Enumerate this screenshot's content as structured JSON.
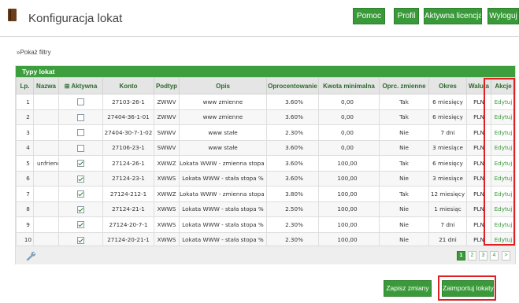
{
  "header": {
    "title": "Konfiguracja lokat",
    "buttons": {
      "help": "Pomoc",
      "profile": "Profil",
      "license": "Aktywna licencja",
      "logout": "Wyloguj"
    }
  },
  "filters_link": "»Pokaż filtry",
  "panel": {
    "title": "Typy lokat",
    "columns": {
      "lp": "Lp.",
      "name": "Nazwa",
      "active": "⊞ Aktywna",
      "account": "Konto",
      "type": "Podtyp",
      "description": "Opis",
      "rate": "Oprocentowanie",
      "min_amount": "Kwota minimalna",
      "rate_change": "Oprc. zmienne",
      "period": "Okres",
      "currency": "Waluta",
      "actions": "Akcje"
    },
    "rows": [
      {
        "lp": "1",
        "name": "",
        "active": false,
        "account": "27103-26-1",
        "type": "ZWWV",
        "description": "www zmienne",
        "rate": "3.60%",
        "min_amount": "0,00",
        "rate_change": "Tak",
        "period": "6 miesięcy",
        "currency": "PLN",
        "action": "Edytuj"
      },
      {
        "lp": "2",
        "name": "",
        "active": false,
        "account": "27404-36-1-01",
        "type": "ZWWV",
        "description": "www zmienne",
        "rate": "3.60%",
        "min_amount": "0,00",
        "rate_change": "Tak",
        "period": "6 miesięcy",
        "currency": "PLN",
        "action": "Edytuj"
      },
      {
        "lp": "3",
        "name": "",
        "active": false,
        "account": "27404-30-7-1-02",
        "type": "SWWV",
        "description": "www stałe",
        "rate": "2.30%",
        "min_amount": "0,00",
        "rate_change": "Nie",
        "period": "7 dni",
        "currency": "PLN",
        "action": "Edytuj"
      },
      {
        "lp": "4",
        "name": "",
        "active": false,
        "account": "27106-23-1",
        "type": "SWWV",
        "description": "www stałe",
        "rate": "3.60%",
        "min_amount": "0,00",
        "rate_change": "Nie",
        "period": "3 miesiące",
        "currency": "PLN",
        "action": "Edytuj"
      },
      {
        "lp": "5",
        "name": "unfriendly",
        "active": true,
        "account": "27124-26-1",
        "type": "XWWZ",
        "description": "Lokata WWW - zmienna stopa %",
        "rate": "3.60%",
        "min_amount": "100,00",
        "rate_change": "Tak",
        "period": "6 miesięcy",
        "currency": "PLN",
        "action": "Edytuj"
      },
      {
        "lp": "6",
        "name": "",
        "active": true,
        "account": "27124-23-1",
        "type": "XWWS",
        "description": "Lokata WWW - stała stopa %",
        "rate": "3.60%",
        "min_amount": "100,00",
        "rate_change": "Nie",
        "period": "3 miesiące",
        "currency": "PLN",
        "action": "Edytuj"
      },
      {
        "lp": "7",
        "name": "",
        "active": true,
        "account": "27124-212-1",
        "type": "XWWZ",
        "description": "Lokata WWW - zmienna stopa %",
        "rate": "3.80%",
        "min_amount": "100,00",
        "rate_change": "Tak",
        "period": "12 miesięcy",
        "currency": "PLN",
        "action": "Edytuj"
      },
      {
        "lp": "8",
        "name": "",
        "active": true,
        "account": "27124-21-1",
        "type": "XWWS",
        "description": "Lokata WWW - stała stopa %",
        "rate": "2.50%",
        "min_amount": "100,00",
        "rate_change": "Nie",
        "period": "1 miesiąc",
        "currency": "PLN",
        "action": "Edytuj"
      },
      {
        "lp": "9",
        "name": "",
        "active": true,
        "account": "27124-20-7-1",
        "type": "XWWS",
        "description": "Lokata WWW - stała stopa %",
        "rate": "2.30%",
        "min_amount": "100,00",
        "rate_change": "Nie",
        "period": "7 dni",
        "currency": "PLN",
        "action": "Edytuj"
      },
      {
        "lp": "10",
        "name": "",
        "active": true,
        "account": "27124-20-21-1",
        "type": "XWWS",
        "description": "Lokata WWW - stała stopa %",
        "rate": "2.30%",
        "min_amount": "100,00",
        "rate_change": "Nie",
        "period": "21 dni",
        "currency": "PLN",
        "action": "Edytuj"
      }
    ],
    "pagination": {
      "pages": [
        "1",
        "2",
        "3",
        "4"
      ],
      "next": ">",
      "current": "1"
    }
  },
  "footer_buttons": {
    "save": "Zapisz zmiany",
    "import": "Zaimportuj lokaty"
  },
  "colors": {
    "accent_green": "#3a9a3a",
    "highlight_red": "#e02020"
  }
}
